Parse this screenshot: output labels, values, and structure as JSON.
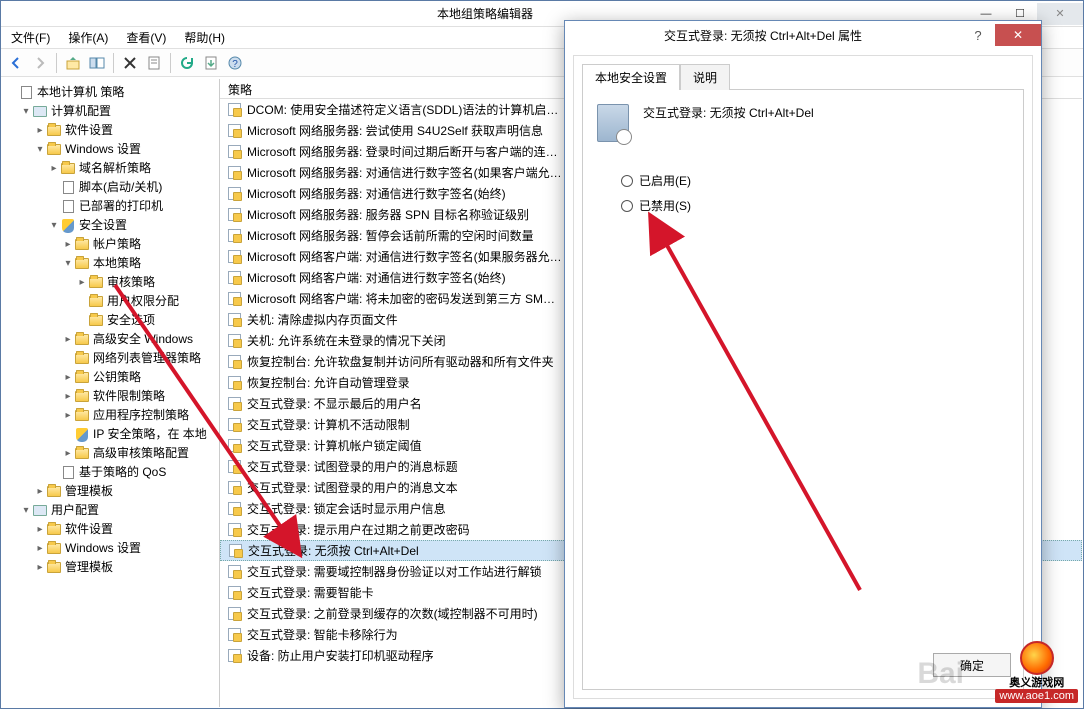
{
  "window": {
    "title": "本地组策略编辑器",
    "menus": [
      "文件(F)",
      "操作(A)",
      "查看(V)",
      "帮助(H)"
    ]
  },
  "tree": [
    {
      "depth": 0,
      "tw": "",
      "icon": "doc",
      "label": "本地计算机 策略"
    },
    {
      "depth": 1,
      "tw": "▾",
      "icon": "comp",
      "label": "计算机配置"
    },
    {
      "depth": 2,
      "tw": "▸",
      "icon": "folder",
      "label": "软件设置"
    },
    {
      "depth": 2,
      "tw": "▾",
      "icon": "folder",
      "label": "Windows 设置"
    },
    {
      "depth": 3,
      "tw": "▸",
      "icon": "folder",
      "label": "域名解析策略"
    },
    {
      "depth": 3,
      "tw": "",
      "icon": "doc",
      "label": "脚本(启动/关机)"
    },
    {
      "depth": 3,
      "tw": "",
      "icon": "doc",
      "label": "已部署的打印机"
    },
    {
      "depth": 3,
      "tw": "▾",
      "icon": "shield",
      "label": "安全设置"
    },
    {
      "depth": 4,
      "tw": "▸",
      "icon": "folder",
      "label": "帐户策略"
    },
    {
      "depth": 4,
      "tw": "▾",
      "icon": "folder",
      "label": "本地策略"
    },
    {
      "depth": 5,
      "tw": "▸",
      "icon": "folder",
      "label": "审核策略"
    },
    {
      "depth": 5,
      "tw": "",
      "icon": "folder",
      "label": "用户权限分配"
    },
    {
      "depth": 5,
      "tw": "",
      "icon": "folder",
      "label": "安全选项"
    },
    {
      "depth": 4,
      "tw": "▸",
      "icon": "folder",
      "label": "高级安全 Windows"
    },
    {
      "depth": 4,
      "tw": "",
      "icon": "folder",
      "label": "网络列表管理器策略"
    },
    {
      "depth": 4,
      "tw": "▸",
      "icon": "folder",
      "label": "公钥策略"
    },
    {
      "depth": 4,
      "tw": "▸",
      "icon": "folder",
      "label": "软件限制策略"
    },
    {
      "depth": 4,
      "tw": "▸",
      "icon": "folder",
      "label": "应用程序控制策略"
    },
    {
      "depth": 4,
      "tw": "",
      "icon": "shield",
      "label": "IP 安全策略，在 本地"
    },
    {
      "depth": 4,
      "tw": "▸",
      "icon": "folder",
      "label": "高级审核策略配置"
    },
    {
      "depth": 3,
      "tw": "",
      "icon": "doc",
      "label": "基于策略的 QoS"
    },
    {
      "depth": 2,
      "tw": "▸",
      "icon": "folder",
      "label": "管理模板"
    },
    {
      "depth": 1,
      "tw": "▾",
      "icon": "comp",
      "label": "用户配置"
    },
    {
      "depth": 2,
      "tw": "▸",
      "icon": "folder",
      "label": "软件设置"
    },
    {
      "depth": 2,
      "tw": "▸",
      "icon": "folder",
      "label": "Windows 设置"
    },
    {
      "depth": 2,
      "tw": "▸",
      "icon": "folder",
      "label": "管理模板"
    }
  ],
  "list": {
    "header": "策略",
    "items": [
      "DCOM: 使用安全描述符定义语言(SDDL)语法的计算机启…",
      "Microsoft 网络服务器: 尝试使用 S4U2Self 获取声明信息",
      "Microsoft 网络服务器: 登录时间过期后断开与客户端的连…",
      "Microsoft 网络服务器: 对通信进行数字签名(如果客户端允…",
      "Microsoft 网络服务器: 对通信进行数字签名(始终)",
      "Microsoft 网络服务器: 服务器 SPN 目标名称验证级别",
      "Microsoft 网络服务器: 暂停会话前所需的空闲时间数量",
      "Microsoft 网络客户端: 对通信进行数字签名(如果服务器允…",
      "Microsoft 网络客户端: 对通信进行数字签名(始终)",
      "Microsoft 网络客户端: 将未加密的密码发送到第三方 SM…",
      "关机: 清除虚拟内存页面文件",
      "关机: 允许系统在未登录的情况下关闭",
      "恢复控制台: 允许软盘复制并访问所有驱动器和所有文件夹",
      "恢复控制台: 允许自动管理登录",
      "交互式登录: 不显示最后的用户名",
      "交互式登录: 计算机不活动限制",
      "交互式登录: 计算机帐户锁定阈值",
      "交互式登录: 试图登录的用户的消息标题",
      "交互式登录: 试图登录的用户的消息文本",
      "交互式登录: 锁定会话时显示用户信息",
      "交互式登录: 提示用户在过期之前更改密码",
      "交互式登录: 无须按 Ctrl+Alt+Del",
      "交互式登录: 需要域控制器身份验证以对工作站进行解锁",
      "交互式登录: 需要智能卡",
      "交互式登录: 之前登录到缓存的次数(域控制器不可用时)",
      "交互式登录: 智能卡移除行为",
      "设备: 防止用户安装打印机驱动程序"
    ],
    "selectedIndex": 21
  },
  "dialog": {
    "title": "交互式登录: 无须按 Ctrl+Alt+Del 属性",
    "tabs": [
      "本地安全设置",
      "说明"
    ],
    "policyName": "交互式登录: 无须按 Ctrl+Alt+Del",
    "radios": [
      "已启用(E)",
      "已禁用(S)"
    ],
    "buttons": {
      "ok": "确定"
    }
  },
  "logo": {
    "name": "奥义游戏网",
    "url": "www.aoe1.com"
  },
  "watermark": "Bai"
}
